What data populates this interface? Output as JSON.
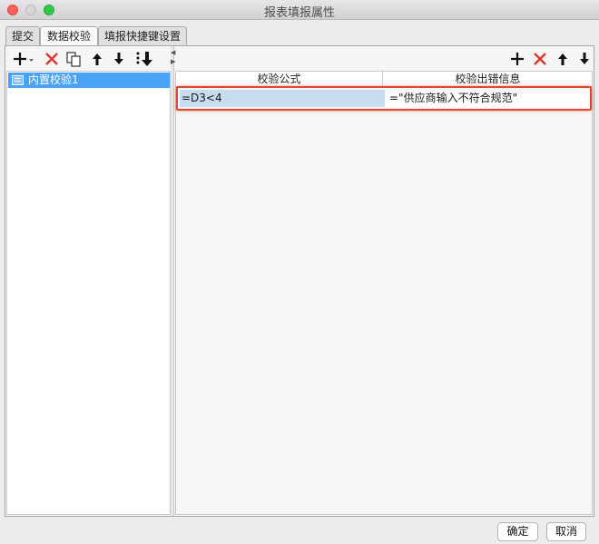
{
  "window": {
    "title": "报表填报属性"
  },
  "tabs": [
    {
      "label": "提交",
      "active": false
    },
    {
      "label": "数据校验",
      "active": true
    },
    {
      "label": "填报快捷键设置",
      "active": false
    }
  ],
  "left_toolbar": {
    "icons": [
      "add-dropdown-icon",
      "delete-icon",
      "copy-icon",
      "move-up-icon",
      "move-down-icon",
      "move-to-bottom-icon"
    ]
  },
  "left_list": {
    "items": [
      {
        "label": "内置校验1",
        "selected": true
      }
    ]
  },
  "right_toolbar": {
    "icons": [
      "add-icon",
      "delete-icon",
      "move-up-icon",
      "move-down-icon"
    ]
  },
  "table": {
    "columns": [
      "校验公式",
      "校验出错信息"
    ],
    "rows": [
      {
        "formula": "=D3<4",
        "message": "=\"供应商输入不符合规范\""
      }
    ]
  },
  "footer": {
    "ok_label": "确定",
    "cancel_label": "取消"
  },
  "colors": {
    "selection": "#4ba3f5",
    "highlight": "#e0472f",
    "delete": "#e0352b"
  }
}
